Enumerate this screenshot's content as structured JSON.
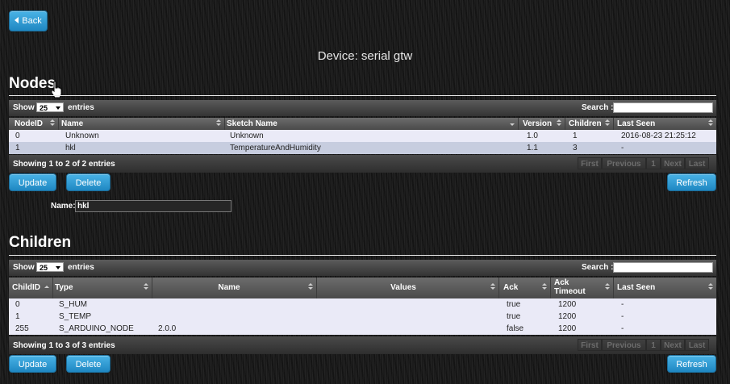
{
  "back_label": "Back",
  "device_title": "Device: serial gtw",
  "nodes": {
    "title": "Nodes",
    "show_label": "Show",
    "page_size": "25",
    "entries_label": "entries",
    "search_label": "Search :",
    "columns": [
      "NodeID",
      "Name",
      "Sketch Name",
      "Version",
      "Children",
      "Last Seen"
    ],
    "rows": [
      [
        "0",
        "Unknown",
        "Unknown",
        "1.0",
        "1",
        "2016-08-23 21:25:12"
      ],
      [
        "1",
        "hkl",
        "TemperatureAndHumidity",
        "1.1",
        "3",
        "-"
      ]
    ],
    "info": "Showing 1 to 2 of 2 entries",
    "pager": [
      "First",
      "Previous",
      "1",
      "Next",
      "Last"
    ],
    "update_label": "Update",
    "delete_label": "Delete",
    "refresh_label": "Refresh",
    "name_label": "Name:",
    "name_value": "hkl"
  },
  "children": {
    "title": "Children",
    "show_label": "Show",
    "page_size": "25",
    "entries_label": "entries",
    "search_label": "Search :",
    "columns": [
      "ChildID",
      "Type",
      "Name",
      "Values",
      "Ack",
      "Ack Timeout",
      "Last Seen"
    ],
    "rows": [
      [
        "0",
        "S_HUM",
        "",
        "",
        "true",
        "1200",
        "-"
      ],
      [
        "1",
        "S_TEMP",
        "",
        "",
        "true",
        "1200",
        "-"
      ],
      [
        "255",
        "S_ARDUINO_NODE",
        "2.0.0",
        "",
        "false",
        "1200",
        "-"
      ]
    ],
    "info": "Showing 1 to 3 of 3 entries",
    "pager": [
      "First",
      "Previous",
      "1",
      "Next",
      "Last"
    ],
    "update_label": "Update",
    "delete_label": "Delete",
    "refresh_label": "Refresh"
  },
  "colors": {
    "button_blue": "#2a95d0",
    "row_odd": "#eaeaf7",
    "row_even": "#c7cddf"
  }
}
